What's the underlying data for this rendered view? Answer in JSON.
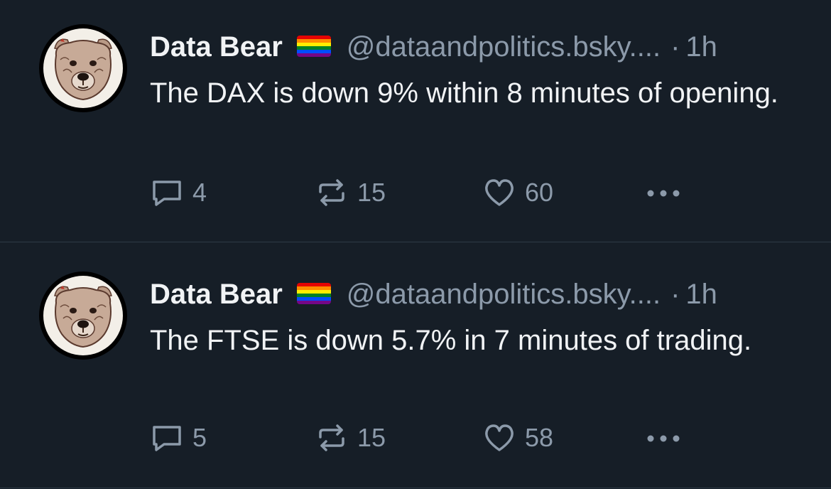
{
  "colors": {
    "background": "#161e27",
    "text_primary": "#f1f3f5",
    "text_secondary": "#8c9aaa",
    "divider": "#2e3a46"
  },
  "posts": [
    {
      "author": "Data Bear",
      "handle": "@dataandpolitics.bsky....",
      "separator": "·",
      "time": "1h",
      "text": "The DAX is down 9% within 8 minutes of opening.",
      "avatar": "bear-avatar",
      "badge": "rainbow-flag",
      "reply_count": "4",
      "repost_count": "15",
      "like_count": "60"
    },
    {
      "author": "Data Bear",
      "handle": "@dataandpolitics.bsky....",
      "separator": "·",
      "time": "1h",
      "text": "The FTSE is down 5.7% in 7 minutes of trading.",
      "avatar": "bear-avatar",
      "badge": "rainbow-flag",
      "reply_count": "5",
      "repost_count": "15",
      "like_count": "58"
    }
  ]
}
